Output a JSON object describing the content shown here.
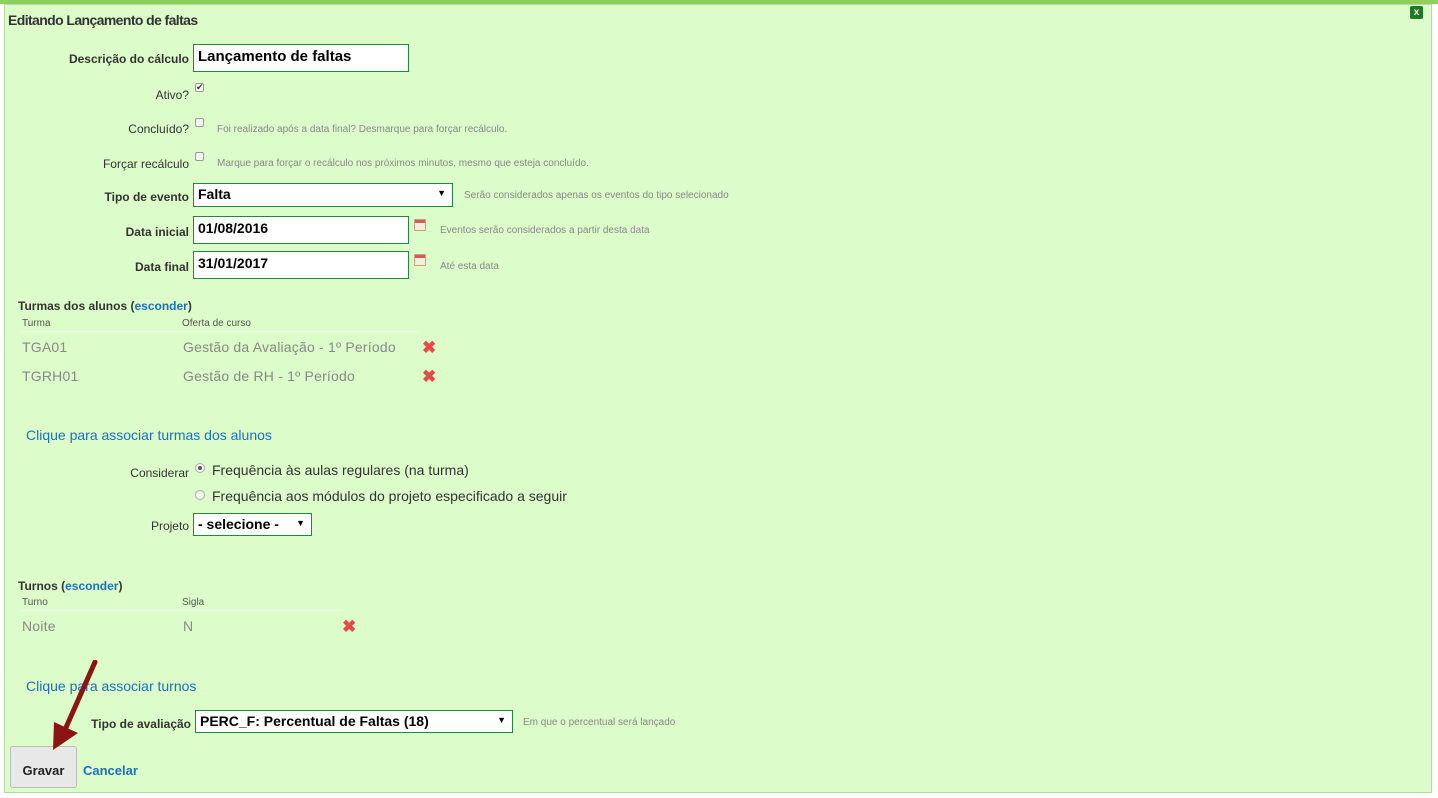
{
  "header": {
    "title": "Editando Lançamento de faltas",
    "close_icon": "close-icon"
  },
  "form": {
    "descricao_label": "Descrição do cálculo",
    "descricao_value": "Lançamento de faltas",
    "ativo_label": "Ativo?",
    "ativo_checked": true,
    "concluido_label": "Concluído?",
    "concluido_hint": "Foi realizado após a data final? Desmarque para forçar recálculo.",
    "forcar_label": "Forçar recálculo",
    "forcar_hint": "Marque para forçar o recálculo nos próximos minutos, mesmo que esteja concluído.",
    "tipo_evento_label": "Tipo de evento",
    "tipo_evento_value": "Falta",
    "tipo_evento_hint": "Serão considerados apenas os eventos do tipo selecionado",
    "data_inicial_label": "Data inicial",
    "data_inicial_value": "01/08/2016",
    "data_inicial_hint": "Eventos serão considerados a partir desta data",
    "data_final_label": "Data final",
    "data_final_value": "31/01/2017",
    "data_final_hint": "Até esta data"
  },
  "turmas": {
    "title": "Turmas dos alunos (",
    "toggle": "esconder",
    "close_paren": ")",
    "col_turma": "Turma",
    "col_oferta": "Oferta de curso",
    "rows": [
      {
        "turma": "TGA01",
        "oferta": "Gestão da Avaliação - 1º Período"
      },
      {
        "turma": "TGRH01",
        "oferta": "Gestão de RH - 1º Período"
      }
    ],
    "associate_link": "Clique para associar turmas dos alunos"
  },
  "considerar": {
    "label": "Considerar",
    "option1": "Frequência às aulas regulares (na turma)",
    "option2": "Frequência aos módulos do projeto especificado a seguir",
    "selected": 1,
    "projeto_label": "Projeto",
    "projeto_value": "- selecione -"
  },
  "turnos": {
    "title": "Turnos (",
    "toggle": "esconder",
    "close_paren": ")",
    "col_turno": "Turno",
    "col_sigla": "Sigla",
    "rows": [
      {
        "turno": "Noite",
        "sigla": "N"
      }
    ],
    "associate_link": "Clique para associar turnos"
  },
  "avaliacao": {
    "label": "Tipo de avaliação",
    "value": "PERC_F: Percentual de Faltas (18)",
    "hint": "Em que o percentual será lançado"
  },
  "actions": {
    "save_label": "Gravar",
    "cancel_label": "Cancelar"
  }
}
